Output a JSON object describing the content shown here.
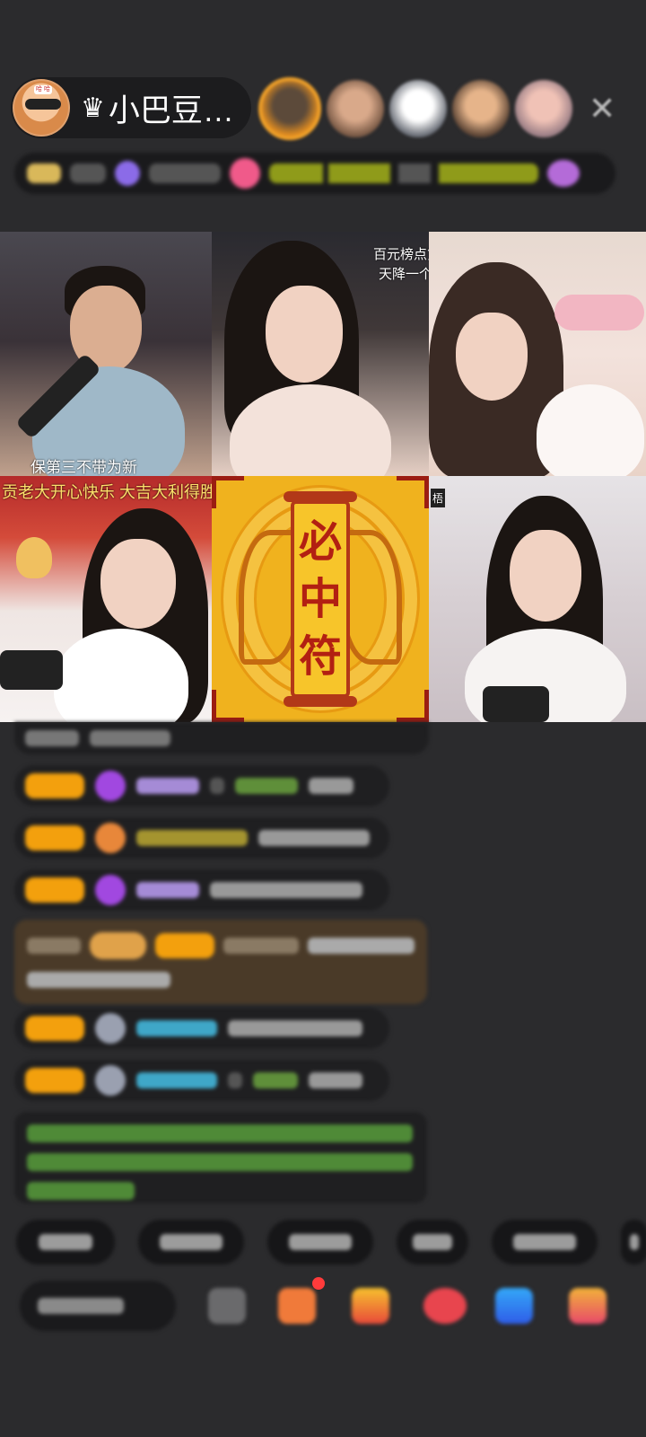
{
  "header": {
    "host_name": "小巴豆…",
    "crown_glyph": "♛",
    "avatar_badge": "哈 哈",
    "close_label": "✕",
    "viewer_count": 5
  },
  "video_tiles": [
    {
      "caption": "保第三不带为新"
    },
    {
      "caption_line1": "百元榜点第",
      "caption_line2": "天降一个"
    },
    {
      "caption": ""
    },
    {
      "caption": "贡老大开心快乐 大吉大利得胜"
    },
    {
      "talisman_chars": [
        "必",
        "中",
        "符"
      ]
    },
    {
      "caption": "梧"
    }
  ],
  "colors": {
    "background": "#2b2b2d",
    "level_badge": "#f3a00d",
    "talisman_yellow": "#f5c240",
    "talisman_red": "#b22012",
    "green_text": "#58b840",
    "cyan_name": "#3fa7c8",
    "purple_name": "#b690e8"
  }
}
